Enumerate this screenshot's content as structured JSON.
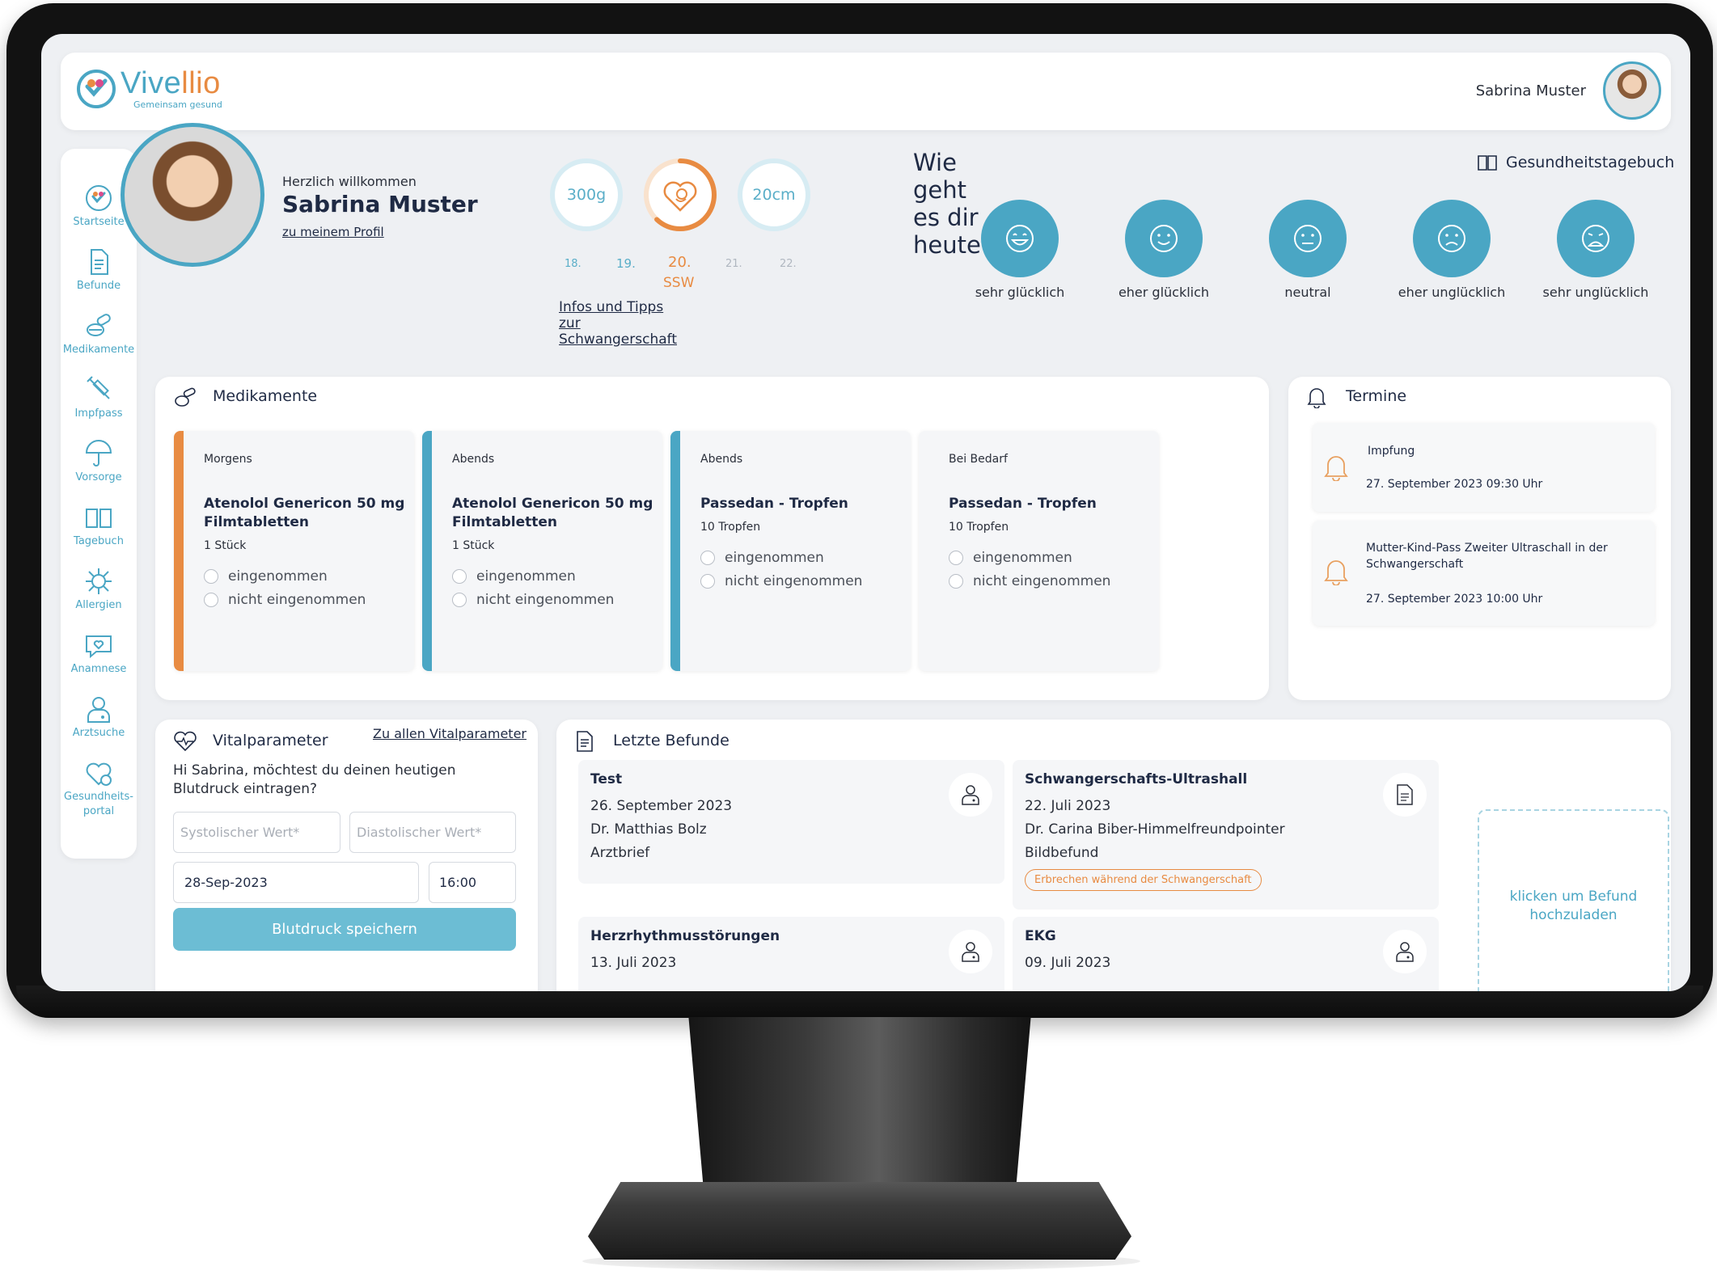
{
  "app": {
    "logo_text_main": "Vive",
    "logo_text_accent": "llio",
    "logo_tagline": "Gemeinsam gesund",
    "user_name": "Sabrina Muster"
  },
  "sidebar": {
    "items": [
      {
        "label": "Startseite",
        "icon": "home-heart-icon"
      },
      {
        "label": "Befunde",
        "icon": "document-icon"
      },
      {
        "label": "Medikamente",
        "icon": "pills-icon"
      },
      {
        "label": "Impfpass",
        "icon": "syringe-icon"
      },
      {
        "label": "Vorsorge",
        "icon": "umbrella-icon"
      },
      {
        "label": "Tagebuch",
        "icon": "book-icon"
      },
      {
        "label": "Allergien",
        "icon": "pollen-icon"
      },
      {
        "label": "Anamnese",
        "icon": "speech-heart-icon"
      },
      {
        "label": "Arztsuche",
        "icon": "doctor-icon"
      },
      {
        "label": "Gesundheits-",
        "label2": "portal",
        "icon": "heart-portal-icon"
      }
    ]
  },
  "welcome": {
    "greeting": "Herzlich willkommen",
    "name": "Sabrina Muster",
    "profile_link": "zu meinem Profil"
  },
  "pregnancy": {
    "weight": "300g",
    "length": "20cm",
    "weeks": [
      "18.",
      "19.",
      "20.",
      "21.",
      "22."
    ],
    "current_week_label": "SSW",
    "progress": 0.62,
    "info_link": "Infos und Tipps zur Schwangerschaft"
  },
  "mood": {
    "title": "Wie geht es dir heute?",
    "diary_link": "Gesundheitstagebuch",
    "options": [
      "sehr glücklich",
      "eher glücklich",
      "neutral",
      "eher unglücklich",
      "sehr unglücklich"
    ]
  },
  "medications": {
    "title": "Medikamente",
    "taken_label": "eingenommen",
    "not_taken_label": "nicht eingenommen",
    "cards": [
      {
        "time": "Morgens",
        "name": "Atenolol Genericon 50 mg Filmtabletten",
        "dose": "1 Stück",
        "accent": "#e88b42"
      },
      {
        "time": "Abends",
        "name": "Atenolol Genericon 50 mg Filmtabletten",
        "dose": "1 Stück",
        "accent": "#4aa6c4"
      },
      {
        "time": "Abends",
        "name": "Passedan - Tropfen",
        "dose": "10 Tropfen",
        "accent": "#4aa6c4"
      },
      {
        "time": "Bei Bedarf",
        "name": "Passedan - Tropfen",
        "dose": "10 Tropfen",
        "accent": ""
      }
    ]
  },
  "appointments": {
    "title": "Termine",
    "items": [
      {
        "title": "Impfung",
        "date": "27. September 2023 09:30 Uhr"
      },
      {
        "title": "Mutter-Kind-Pass Zweiter Ultraschall in der Schwangerschaft",
        "date": "27. September 2023 10:00 Uhr"
      }
    ]
  },
  "vitals": {
    "title": "Vitalparameter",
    "all_link": "Zu allen Vitalparameter",
    "prompt": "Hi Sabrina, möchtest du deinen heutigen Blutdruck eintragen?",
    "systolic_placeholder": "Systolischer Wert*",
    "diastolic_placeholder": "Diastolischer Wert*",
    "date": "28-Sep-2023",
    "time": "16:00",
    "save_label": "Blutdruck speichern"
  },
  "findings": {
    "title": "Letzte Befunde",
    "upload_label": "klicken um Befund hochzuladen",
    "items": [
      {
        "title": "Test",
        "date": "26. September 2023",
        "doctor": "Dr. Matthias Bolz",
        "type": "Arztbrief",
        "icon": "doctor-icon"
      },
      {
        "title": "Schwangerschafts-Ultrashall",
        "date": "22. Juli 2023",
        "doctor": "Dr. Carina Biber-Himmelfreundpointer",
        "type": "Bildbefund",
        "badge": "Erbrechen während der Schwangerschaft",
        "icon": "document-icon"
      },
      {
        "title": "Herzrhythmusstörungen",
        "date": "13. Juli 2023",
        "icon": "doctor-icon"
      },
      {
        "title": "EKG",
        "date": "09. Juli 2023",
        "icon": "doctor-icon"
      }
    ]
  }
}
